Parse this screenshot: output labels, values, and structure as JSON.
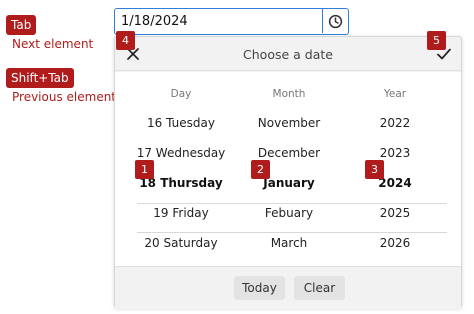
{
  "legend": {
    "tab_key": "Tab",
    "tab_desc": "Next element",
    "shift_tab_key": "Shift+Tab",
    "shift_tab_desc": "Previous element"
  },
  "date_input": {
    "value": "1/18/2024",
    "button_icon": "clock-icon"
  },
  "picker": {
    "title": "Choose a date",
    "close_icon": "close-icon",
    "confirm_icon": "check-icon",
    "columns": {
      "day": {
        "header": "Day",
        "items": [
          "16 Tuesday",
          "17 Wednesday",
          "18 Thursday",
          "19 Friday",
          "20 Saturday"
        ],
        "selected": "18 Thursday"
      },
      "month": {
        "header": "Month",
        "items": [
          "November",
          "December",
          "January",
          "Febuary",
          "March"
        ],
        "selected": "January"
      },
      "year": {
        "header": "Year",
        "items": [
          "2022",
          "2023",
          "2024",
          "2025",
          "2026"
        ],
        "selected": "2024"
      }
    },
    "footer": {
      "today_label": "Today",
      "clear_label": "Clear"
    }
  },
  "badges": [
    "1",
    "2",
    "3",
    "4",
    "5"
  ],
  "colors": {
    "accent_red": "#b01c1c",
    "focus_blue": "#2f7ed8"
  }
}
